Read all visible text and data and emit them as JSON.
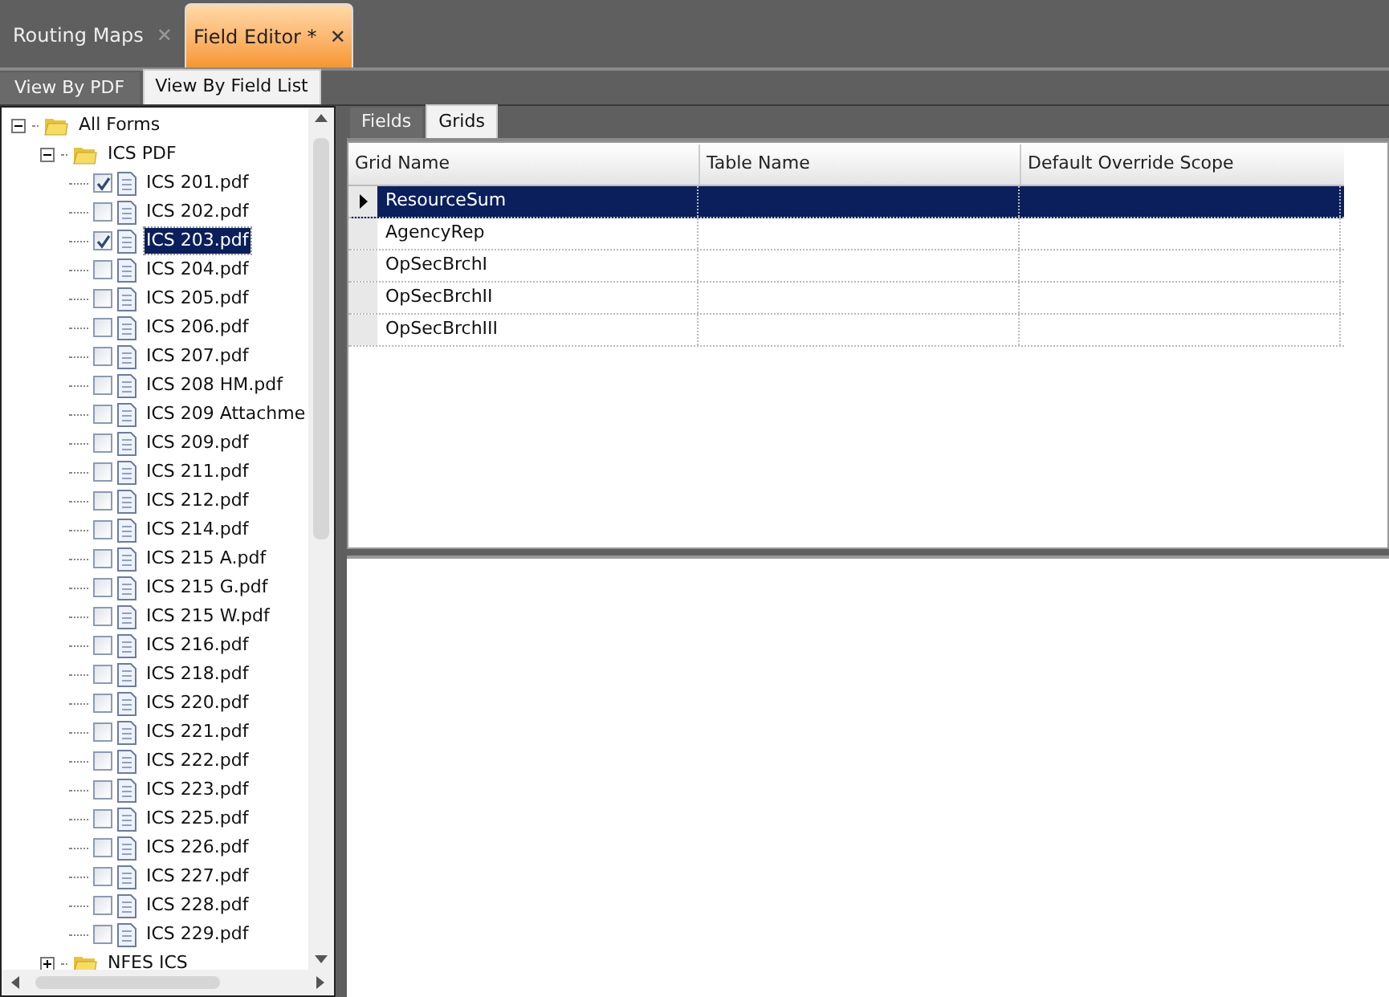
{
  "document_tabs": [
    {
      "label": "Routing Maps",
      "selected": false,
      "close": "✕"
    },
    {
      "label": "Field Editor *",
      "selected": true,
      "close": "✕"
    }
  ],
  "view_tabs": [
    {
      "label": "View By PDF",
      "selected": false
    },
    {
      "label": "View By Field List",
      "selected": true
    }
  ],
  "tree": [
    {
      "label": "All Forms",
      "kind": "folder",
      "expanded": true,
      "children": [
        {
          "label": "ICS PDF",
          "kind": "folder",
          "expanded": true,
          "children": [
            {
              "label": "ICS 201.pdf",
              "kind": "file",
              "checked": true,
              "selected": false
            },
            {
              "label": "ICS 202.pdf",
              "kind": "file",
              "checked": false,
              "selected": false
            },
            {
              "label": "ICS 203.pdf",
              "kind": "file",
              "checked": true,
              "selected": true
            },
            {
              "label": "ICS 204.pdf",
              "kind": "file",
              "checked": false,
              "selected": false
            },
            {
              "label": "ICS 205.pdf",
              "kind": "file",
              "checked": false,
              "selected": false
            },
            {
              "label": "ICS 206.pdf",
              "kind": "file",
              "checked": false,
              "selected": false
            },
            {
              "label": "ICS 207.pdf",
              "kind": "file",
              "checked": false,
              "selected": false
            },
            {
              "label": "ICS 208 HM.pdf",
              "kind": "file",
              "checked": false,
              "selected": false
            },
            {
              "label": "ICS 209 Attachme",
              "kind": "file",
              "checked": false,
              "selected": false
            },
            {
              "label": "ICS 209.pdf",
              "kind": "file",
              "checked": false,
              "selected": false
            },
            {
              "label": "ICS 211.pdf",
              "kind": "file",
              "checked": false,
              "selected": false
            },
            {
              "label": "ICS 212.pdf",
              "kind": "file",
              "checked": false,
              "selected": false
            },
            {
              "label": "ICS 214.pdf",
              "kind": "file",
              "checked": false,
              "selected": false
            },
            {
              "label": "ICS 215 A.pdf",
              "kind": "file",
              "checked": false,
              "selected": false
            },
            {
              "label": "ICS 215 G.pdf",
              "kind": "file",
              "checked": false,
              "selected": false
            },
            {
              "label": "ICS 215 W.pdf",
              "kind": "file",
              "checked": false,
              "selected": false
            },
            {
              "label": "ICS 216.pdf",
              "kind": "file",
              "checked": false,
              "selected": false
            },
            {
              "label": "ICS 218.pdf",
              "kind": "file",
              "checked": false,
              "selected": false
            },
            {
              "label": "ICS 220.pdf",
              "kind": "file",
              "checked": false,
              "selected": false
            },
            {
              "label": "ICS 221.pdf",
              "kind": "file",
              "checked": false,
              "selected": false
            },
            {
              "label": "ICS 222.pdf",
              "kind": "file",
              "checked": false,
              "selected": false
            },
            {
              "label": "ICS 223.pdf",
              "kind": "file",
              "checked": false,
              "selected": false
            },
            {
              "label": "ICS 225.pdf",
              "kind": "file",
              "checked": false,
              "selected": false
            },
            {
              "label": "ICS 226.pdf",
              "kind": "file",
              "checked": false,
              "selected": false
            },
            {
              "label": "ICS 227.pdf",
              "kind": "file",
              "checked": false,
              "selected": false
            },
            {
              "label": "ICS 228.pdf",
              "kind": "file",
              "checked": false,
              "selected": false
            },
            {
              "label": "ICS 229.pdf",
              "kind": "file",
              "checked": false,
              "selected": false
            }
          ]
        },
        {
          "label": "NFES ICS",
          "kind": "folder",
          "expanded": false
        }
      ]
    }
  ],
  "editor_tabs": [
    {
      "label": "Fields",
      "selected": false
    },
    {
      "label": "Grids",
      "selected": true
    }
  ],
  "grid": {
    "columns": [
      "Grid Name",
      "Table Name",
      "Default Override Scope"
    ],
    "rows": [
      {
        "cells": [
          "ResourceSum",
          "",
          ""
        ],
        "selected": true
      },
      {
        "cells": [
          "AgencyRep",
          "",
          ""
        ],
        "selected": false
      },
      {
        "cells": [
          "OpSecBrchI",
          "",
          ""
        ],
        "selected": false
      },
      {
        "cells": [
          "OpSecBrchII",
          "",
          ""
        ],
        "selected": false
      },
      {
        "cells": [
          "OpSecBrchIII",
          "",
          ""
        ],
        "selected": false
      }
    ]
  }
}
